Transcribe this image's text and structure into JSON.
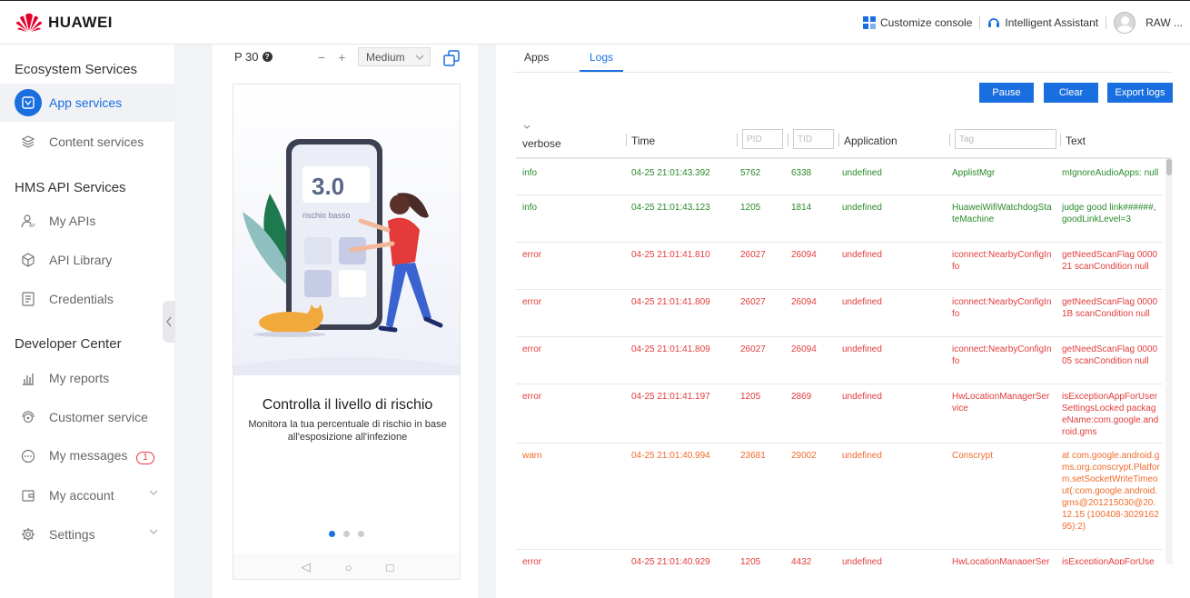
{
  "header": {
    "brand": "HUAWEI",
    "customize": "Customize console",
    "assistant": "Intelligent Assistant",
    "user": "RAW ..."
  },
  "sidebar": {
    "ecosystem_title": "Ecosystem Services",
    "app_services": "App services",
    "content_services": "Content services",
    "hms_title": "HMS API Services",
    "my_apis": "My APIs",
    "api_library": "API Library",
    "credentials": "Credentials",
    "developer_title": "Developer Center",
    "my_reports": "My reports",
    "customer_service": "Customer service",
    "my_messages": "My messages",
    "messages_badge": "1",
    "my_account": "My account",
    "settings": "Settings"
  },
  "device": {
    "model": "P 30",
    "zoom_out": "−",
    "zoom_in": "+",
    "size": "Medium",
    "card_value": "3.0",
    "card_label": "rischio basso",
    "title": "Controlla il livello di rischio",
    "subtitle": "Monitora la tua percentuale di rischio in base all'esposizione all'infezione",
    "nav_back": "◁",
    "nav_home": "○",
    "nav_recent": "□"
  },
  "logs": {
    "tab_apps": "Apps",
    "tab_logs": "Logs",
    "pause": "Pause",
    "clear": "Clear",
    "export": "Export logs",
    "level_filter": "verbose",
    "col_time": "Time",
    "pid_placeholder": "PID",
    "tid_placeholder": "TID",
    "col_application": "Application",
    "tag_placeholder": "Tag",
    "col_text": "Text",
    "rows": [
      {
        "level": "info",
        "time": "04-25 21:01:43.392",
        "pid": "5762",
        "tid": "6338",
        "app": "undefined",
        "tag": "ApplistMgr",
        "text": "mIgnoreAudioApps: null"
      },
      {
        "level": "info",
        "time": "04-25 21:01:43.123",
        "pid": "1205",
        "tid": "1814",
        "app": "undefined",
        "tag": "HuaweiWifiWatchdogStateMachine",
        "text": "judge good link######, goodLinkLevel=3"
      },
      {
        "level": "error",
        "time": "04-25 21:01:41.810",
        "pid": "26027",
        "tid": "26094",
        "app": "undefined",
        "tag": "iconnect:NearbyConfigInfo",
        "text": "getNeedScanFlag 000021 scanCondition null"
      },
      {
        "level": "error",
        "time": "04-25 21:01:41.809",
        "pid": "26027",
        "tid": "26094",
        "app": "undefined",
        "tag": "iconnect:NearbyConfigInfo",
        "text": "getNeedScanFlag 00001B scanCondition null"
      },
      {
        "level": "error",
        "time": "04-25 21:01:41.809",
        "pid": "26027",
        "tid": "26094",
        "app": "undefined",
        "tag": "iconnect:NearbyConfigInfo",
        "text": "getNeedScanFlag 000005 scanCondition null"
      },
      {
        "level": "error",
        "time": "04-25 21:01:41.197",
        "pid": "1205",
        "tid": "2869",
        "app": "undefined",
        "tag": "HwLocationManagerService",
        "text": "isExceptionAppForUserSettingsLocked packageName:com.google.android.gms"
      },
      {
        "level": "warn",
        "time": "04-25 21:01:40.994",
        "pid": "23681",
        "tid": "29002",
        "app": "undefined",
        "tag": "Conscrypt",
        "text": "at com.google.android.gms.org.conscrypt.Platform.setSocketWriteTimeout(:com.google.android.gms@201215030@20.12.15 (100408-302916295):2)"
      },
      {
        "level": "error",
        "time": "04-25 21:01:40.929",
        "pid": "1205",
        "tid": "4432",
        "app": "undefined",
        "tag": "HwLocationManagerService",
        "text": "isExceptionAppForUse"
      }
    ]
  },
  "colors": {
    "accent": "#1a6fe0",
    "info": "#2a8a2a",
    "error": "#e23c3c",
    "warn": "#f06b2a",
    "brand_red": "#e4002b"
  }
}
